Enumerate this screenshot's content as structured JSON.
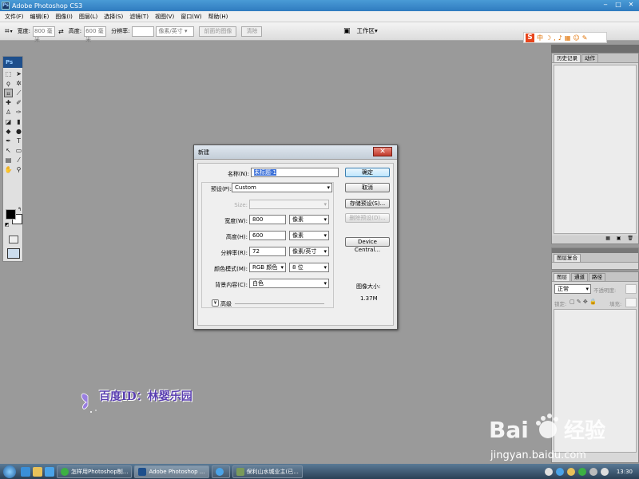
{
  "window": {
    "title": "Adobe Photoshop CS3",
    "controls": [
      "‒",
      "□",
      "✕"
    ]
  },
  "menu": [
    "文件(F)",
    "编辑(E)",
    "图像(I)",
    "图层(L)",
    "选择(S)",
    "滤镜(T)",
    "视图(V)",
    "窗口(W)",
    "帮助(H)"
  ],
  "options_bar": {
    "width_label": "宽度:",
    "width_value": "800 毫米",
    "height_label": "高度:",
    "height_value": "600 毫米",
    "resolution_label": "分辨率:",
    "resolution_value": "",
    "unit": "像素/英寸",
    "front_image_btn": "前面的图像",
    "clear_btn": "清除",
    "workspace": "工作区"
  },
  "ime": {
    "logo": "S",
    "mode": "中"
  },
  "toolbox": {
    "logo": "Ps",
    "foreground": "#000000",
    "background": "#ffffff"
  },
  "panels": {
    "history": {
      "tabs": [
        "历史记录",
        "动作"
      ]
    },
    "navigator": {
      "tabs": [
        "图层复合"
      ]
    },
    "layers": {
      "tabs": [
        "图层",
        "通道",
        "路径"
      ],
      "blend_mode": "正常",
      "opacity_label": "不透明度:",
      "lock_label": "锁定:",
      "fill_label": "填充:"
    }
  },
  "dialog": {
    "title": "新建",
    "name_label": "名称(N):",
    "name_value": "未标题-1",
    "preset_label": "预设(P):",
    "preset_value": "Custom",
    "size_label": "Size:",
    "size_value": "",
    "width_label": "宽度(W):",
    "width_value": "800",
    "width_unit": "像素",
    "height_label": "高度(H):",
    "height_value": "600",
    "height_unit": "像素",
    "resolution_label": "分辨率(R):",
    "resolution_value": "72",
    "resolution_unit": "像素/英寸",
    "color_mode_label": "颜色模式(M):",
    "color_mode_value": "RGB 颜色",
    "bit_depth": "8 位",
    "background_label": "背景内容(C):",
    "background_value": "白色",
    "advanced_label": "高级",
    "ok": "确定",
    "cancel": "取消",
    "save_preset": "存储预设(S)...",
    "delete_preset": "删除预设(D)...",
    "device_central": "Device Central...",
    "image_size_label": "图像大小:",
    "image_size_value": "1.37M"
  },
  "watermark": {
    "text": "百度ID：林婴乐园",
    "baidu_url": "jingyan.baidu.com"
  },
  "taskbar": {
    "tasks": [
      "怎样用Photoshop制...",
      "Adobe Photoshop ...",
      "",
      "保利山水城业主(已..."
    ],
    "clock": "13:30"
  },
  "colors": {
    "canvas": "#9a9a9a",
    "titlebar": "#2f7bbf",
    "watermark": "#5a3fb0"
  }
}
